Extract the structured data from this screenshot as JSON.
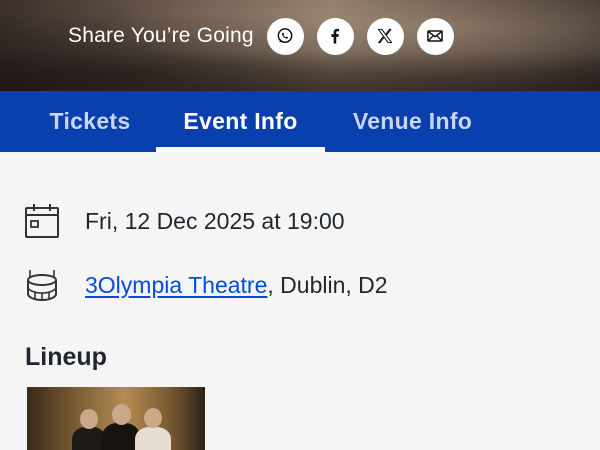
{
  "share": {
    "label": "Share You’re Going",
    "buttons": [
      {
        "name": "whatsapp-icon"
      },
      {
        "name": "facebook-icon"
      },
      {
        "name": "x-icon"
      },
      {
        "name": "email-icon"
      }
    ]
  },
  "tabs": [
    {
      "label": "Tickets",
      "active": false
    },
    {
      "label": "Event Info",
      "active": true
    },
    {
      "label": "Venue Info",
      "active": false
    }
  ],
  "event": {
    "date_text": "Fri, 12 Dec 2025 at 19:00",
    "venue_link": "3Olympia Theatre",
    "venue_rest": ", Dublin, D2"
  },
  "lineup": {
    "title": "Lineup"
  },
  "colors": {
    "tab_bar": "#0a3fae",
    "link": "#024ddf",
    "text": "#1f262d",
    "background": "#f5f5f5"
  }
}
